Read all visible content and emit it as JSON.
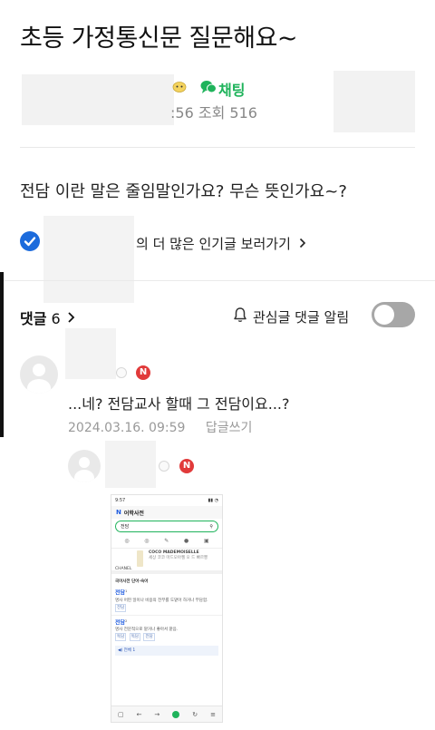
{
  "post": {
    "title": "초등 가정통신문 질문해요~",
    "chat_label": "채팅",
    "time_fragment": ":56",
    "views_label": "조회",
    "views_count": "516",
    "question": "전담 이란 말은 줄임말인가요? 무슨 뜻인가요~?",
    "popular_link": "의 더 많은 인기글 보러가기"
  },
  "comments": {
    "header_label": "댓글",
    "count": "6",
    "notify_label": "관심글 댓글 알림",
    "notify_on": false,
    "items": [
      {
        "badge": "N",
        "text": "...네? 전담교사 할때 그 전담이요...?",
        "date": "2024.03.16. 09:59",
        "reply_label": "답글쓰기"
      },
      {
        "badge": "N"
      }
    ]
  },
  "attachment": {
    "status_time": "9:57",
    "app_title": "어학사전",
    "search_value": "전담",
    "ad_brand": "CHANEL",
    "ad_product": "COCO MADEMOISELLE",
    "ad_desc": "세상 코코 마드모아젤 오 드 빠르뿡",
    "section_title": "국어사전 단어·숙어",
    "entry1_word": "전담",
    "entry1_desc": "명사 어떤 일이나 비용의 전부를 도맡아 하거나 부담함.",
    "entry1_tag": "전담",
    "entry2_word": "전담",
    "entry2_desc": "명사 전문적으로 맡거나 좋아서 맡음.",
    "entry2_tags": [
      "독담",
      "독담",
      "전담"
    ],
    "audio_label": "전체 1"
  },
  "colors": {
    "accent_green": "#1fb35b",
    "verified_blue": "#1c6bdc",
    "badge_red": "#e13a3a",
    "toggle_off": "#a7a7a7"
  }
}
